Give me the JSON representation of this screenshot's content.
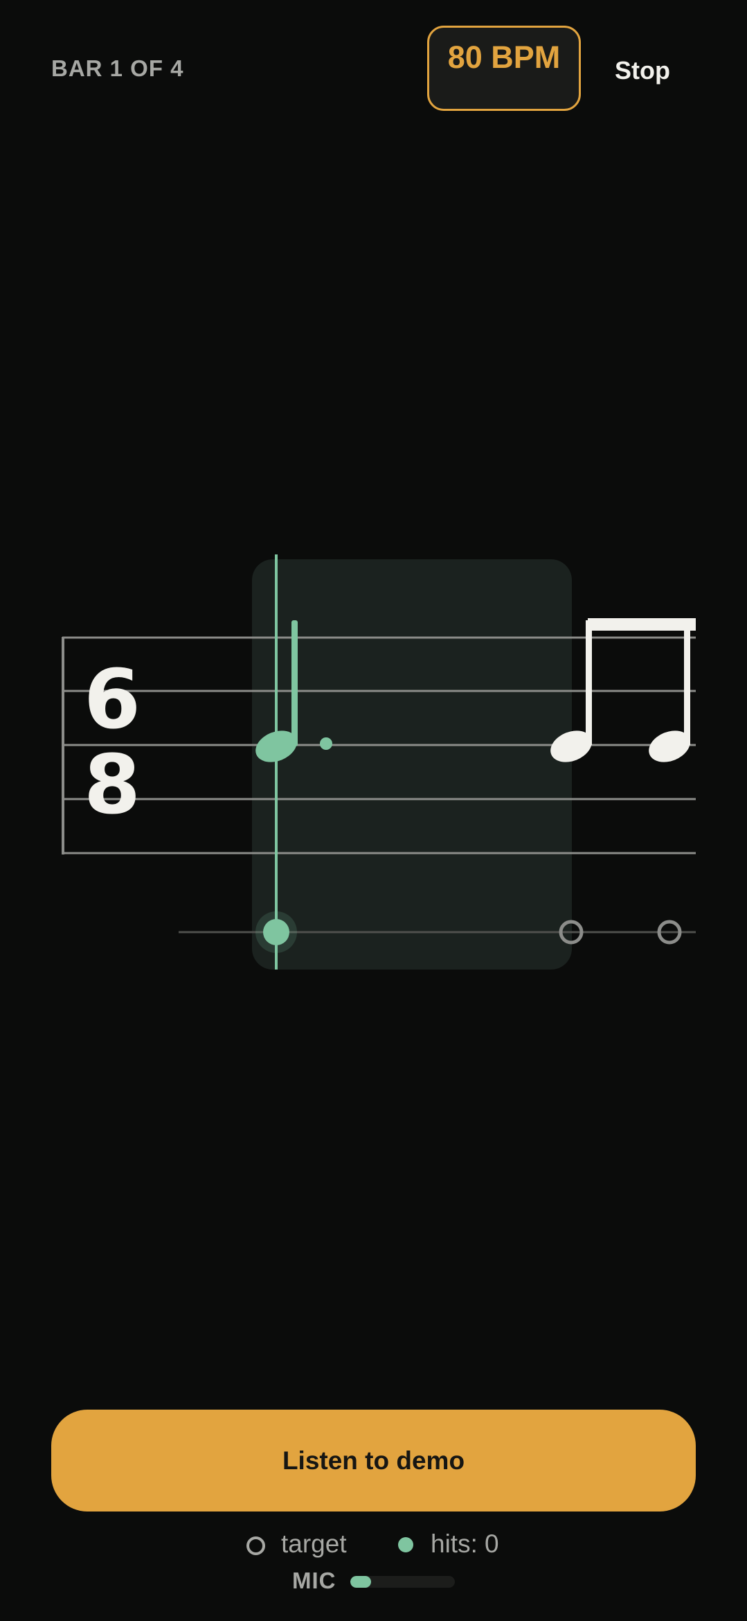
{
  "header": {
    "bar_counter": "BAR 1 OF 4",
    "bpm_label": "80 BPM",
    "stop_label": "Stop"
  },
  "score": {
    "time_signature": {
      "numerator": "6",
      "denominator": "8"
    },
    "notes": [
      {
        "value": "dotted quarter",
        "state": "active"
      },
      {
        "value": "eighth",
        "state": "upcoming"
      },
      {
        "value": "eighth",
        "state": "upcoming"
      }
    ],
    "beat_markers": [
      {
        "state": "current"
      },
      {
        "state": "target"
      },
      {
        "state": "target"
      }
    ]
  },
  "actions": {
    "demo_label": "Listen to demo"
  },
  "legend": {
    "target_label": "target",
    "hits_prefix": "hits:",
    "hits_count": "0",
    "mic_label": "MIC",
    "mic_level": 0.2
  },
  "colors": {
    "accent": "#e2a43f",
    "hit_green": "#7fc5a0",
    "ink": "#f2f1ec",
    "muted": "#a7a8a4",
    "background": "#0b0c0b"
  }
}
